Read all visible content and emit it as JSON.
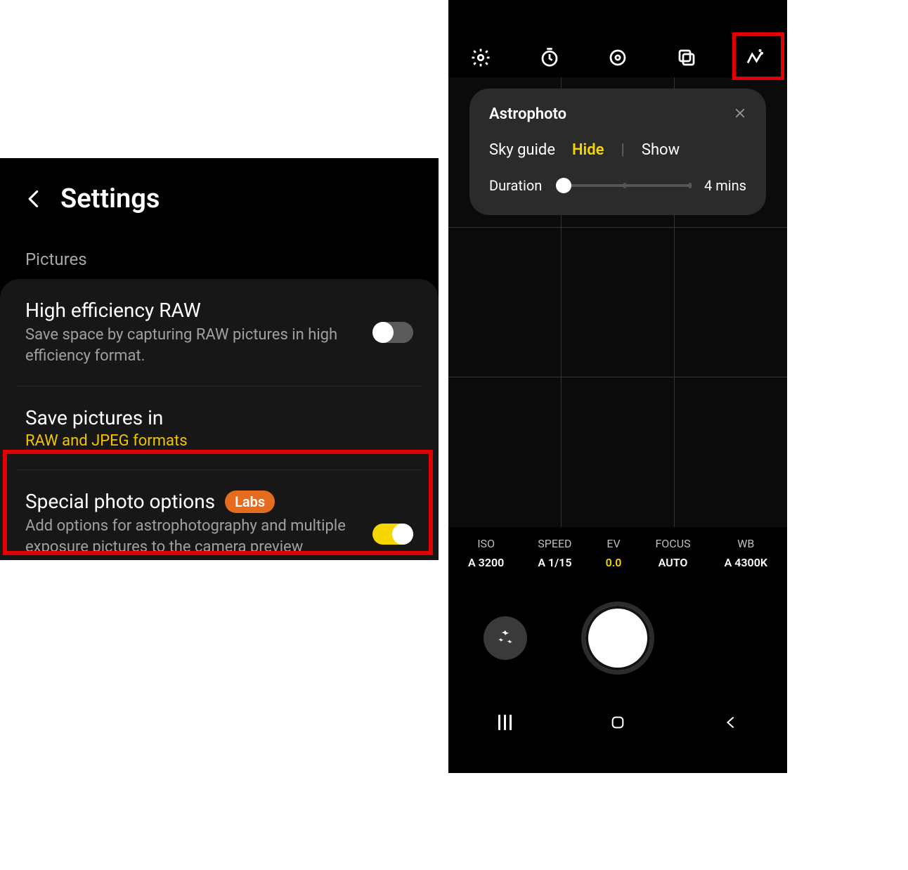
{
  "settings": {
    "title": "Settings",
    "section_label": "Pictures",
    "items": [
      {
        "title": "High efficiency RAW",
        "desc": "Save space by capturing RAW pictures in high efficiency format.",
        "toggle": "off"
      },
      {
        "title": "Save pictures in",
        "sub": "RAW and JPEG formats"
      },
      {
        "title": "Special photo options",
        "badge": "Labs",
        "desc": "Add options for astrophotography and multiple exposure pictures to the camera preview screen.",
        "toggle": "on"
      }
    ]
  },
  "camera": {
    "popup": {
      "title": "Astrophoto",
      "sky_guide_label": "Sky guide",
      "hide_label": "Hide",
      "show_label": "Show",
      "sky_guide_value": "Hide",
      "duration_label": "Duration",
      "duration_value": "4 mins"
    },
    "params": [
      {
        "label": "ISO",
        "value": "A 3200"
      },
      {
        "label": "SPEED",
        "value": "A 1/15"
      },
      {
        "label": "EV",
        "value": "0.0"
      },
      {
        "label": "FOCUS",
        "value": "AUTO"
      },
      {
        "label": "WB",
        "value": "A 4300K"
      }
    ]
  }
}
